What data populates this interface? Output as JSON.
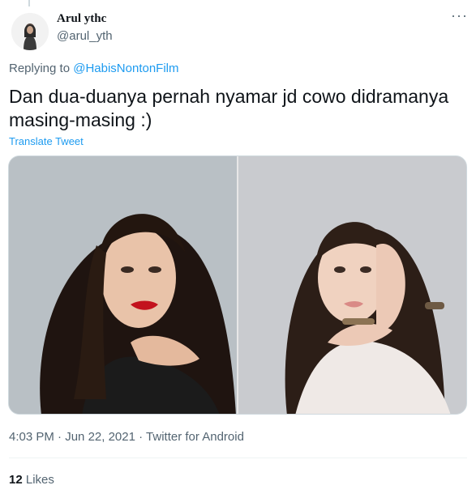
{
  "tweet": {
    "author": {
      "name": "Arul ythc",
      "handle": "@arul_yth"
    },
    "more_icon": "more-horizontal-icon",
    "replying": {
      "prefix": "Replying to ",
      "mention": "@HabisNontonFilm"
    },
    "text": "Dan dua-duanya pernah nyamar jd cowo didramanya masing-masing :)",
    "translate_label": "Translate Tweet",
    "meta": {
      "time": "4:03 PM",
      "sep1": " · ",
      "date": "Jun 22, 2021",
      "sep2": " · ",
      "source": "Twitter for Android"
    },
    "likes": {
      "count": "12",
      "label": "Likes"
    },
    "colors": {
      "link": "#1d9bf0",
      "secondary": "#536471",
      "text": "#0f1419"
    }
  }
}
